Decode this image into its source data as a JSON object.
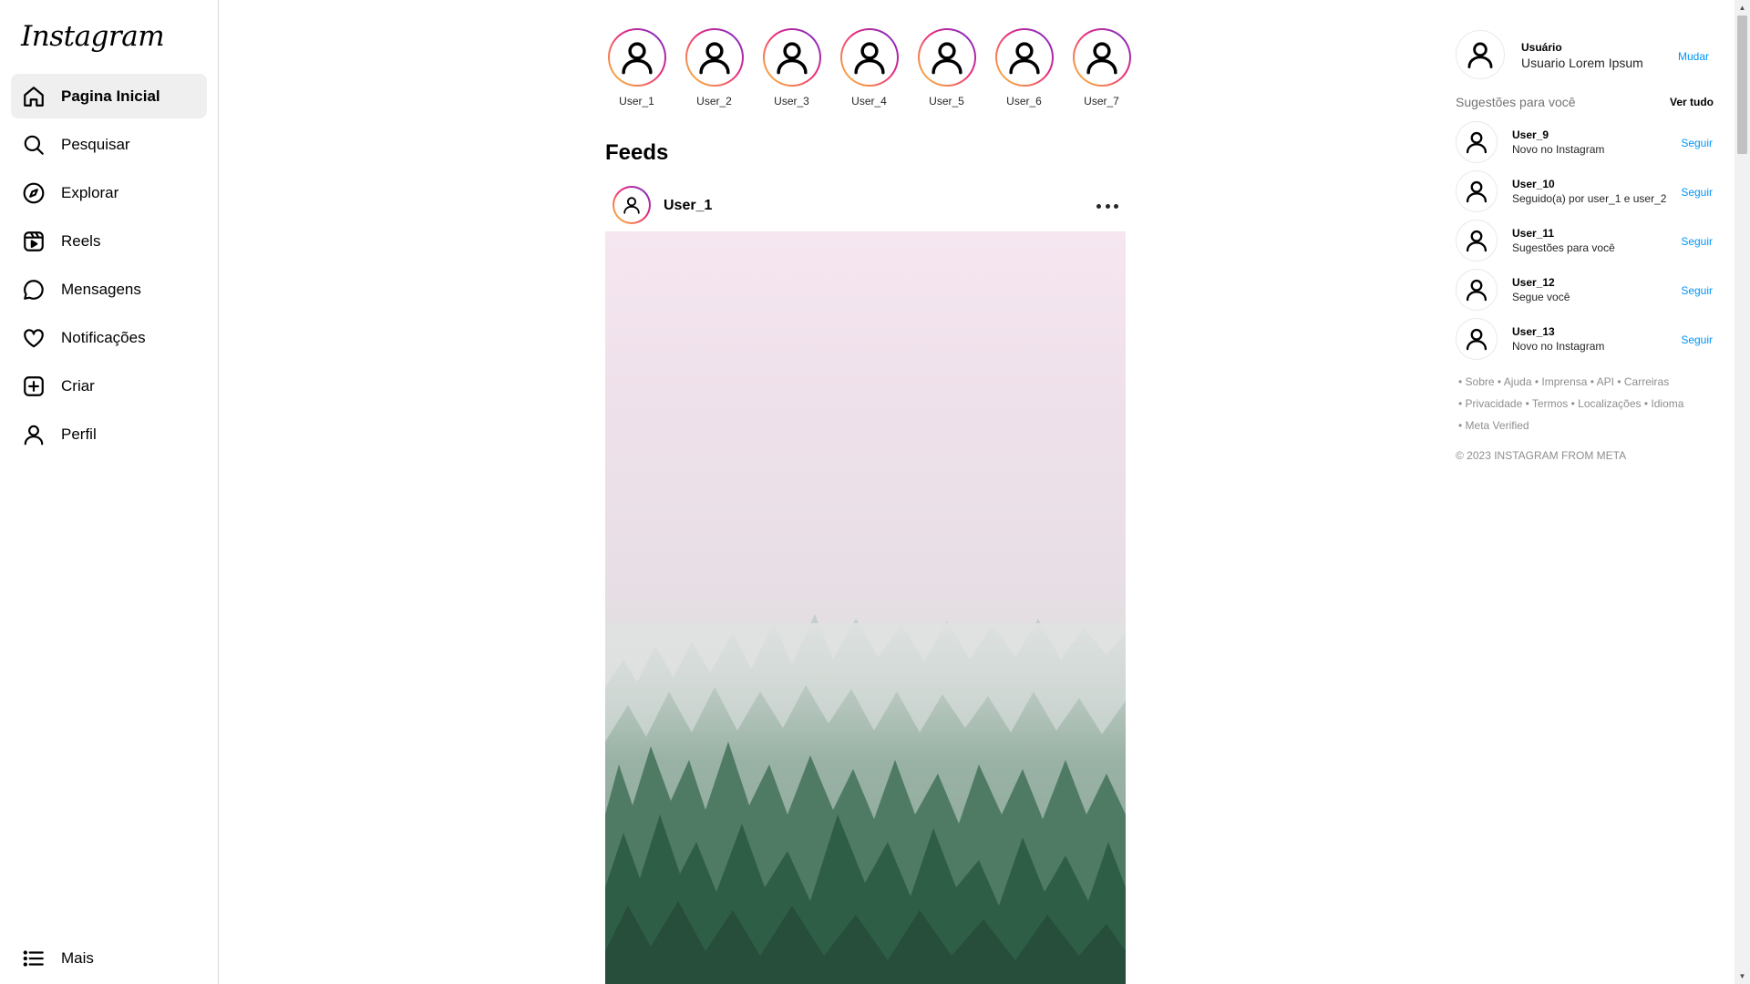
{
  "app": {
    "logo_text": "Instagram"
  },
  "sidebar": {
    "items": [
      {
        "label": "Pagina Inicial",
        "icon": "home-icon",
        "active": true
      },
      {
        "label": "Pesquisar",
        "icon": "search-icon"
      },
      {
        "label": "Explorar",
        "icon": "compass-icon"
      },
      {
        "label": "Reels",
        "icon": "reels-icon"
      },
      {
        "label": "Mensagens",
        "icon": "message-icon"
      },
      {
        "label": "Notificações",
        "icon": "heart-icon"
      },
      {
        "label": "Criar",
        "icon": "plus-square-icon"
      },
      {
        "label": "Perfil",
        "icon": "user-icon"
      }
    ],
    "more": {
      "label": "Mais",
      "icon": "menu-icon"
    }
  },
  "stories": [
    {
      "name": "User_1"
    },
    {
      "name": "User_2"
    },
    {
      "name": "User_3"
    },
    {
      "name": "User_4"
    },
    {
      "name": "User_5"
    },
    {
      "name": "User_6"
    },
    {
      "name": "User_7"
    }
  ],
  "feed": {
    "title": "Feeds",
    "post": {
      "username": "User_1",
      "more_icon": "more-horizontal-icon"
    }
  },
  "profile": {
    "username": "Usuário",
    "full_name": "Usuario Lorem Ipsum",
    "switch_label": "Mudar"
  },
  "suggestions": {
    "title": "Sugestões para você",
    "see_all": "Ver tudo",
    "follow_label": "Seguir",
    "items": [
      {
        "name": "User_9",
        "subtitle": "Novo no Instagram"
      },
      {
        "name": "User_10",
        "subtitle": "Seguido(a) por user_1 e user_2"
      },
      {
        "name": "User_11",
        "subtitle": "Sugestões para você"
      },
      {
        "name": "User_12",
        "subtitle": "Segue você"
      },
      {
        "name": "User_13",
        "subtitle": "Novo no Instagram"
      }
    ]
  },
  "footer": {
    "links_row1": [
      "Sobre",
      "Ajuda",
      "Imprensa",
      "API",
      "Carreiras"
    ],
    "links_row2": [
      "Privacidade",
      "Termos",
      "Localizações",
      "Idioma"
    ],
    "links_row3": [
      "Meta Verified"
    ],
    "separator": "•",
    "copyright": "© 2023 INSTAGRAM FROM META"
  },
  "colors": {
    "accent": "#0095f6",
    "story_ring_start": "#f9ce34",
    "story_ring_mid": "#ee2a7b",
    "story_ring_end": "#6228d7",
    "muted_text": "#8e8e8e"
  }
}
